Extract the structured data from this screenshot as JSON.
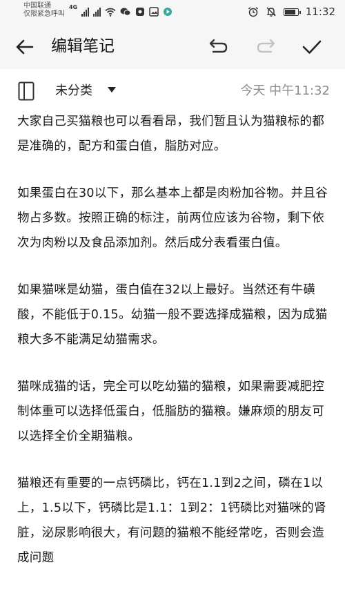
{
  "status_bar": {
    "carrier_line1": "中国联通",
    "carrier_line2": "仅限紧急呼叫",
    "network": "4G",
    "time": "11:32",
    "battery_level": 0.85
  },
  "app_bar": {
    "title": "编辑笔记"
  },
  "note": {
    "category": "未分类",
    "timestamp": "今天 中午11:32",
    "paragraphs": [
      "大家自己买猫粮也可以看看昂，我们暂且认为猫粮标的都是准确的，配方和蛋白值，脂肪对应。",
      "如果蛋白在30以下，那么基本上都是肉粉加谷物。并且谷物占多数。按照正确的标注，前两位应该为谷物，剩下依次为肉粉以及食品添加剂。然后成分表看蛋白值。",
      "如果猫咪是幼猫，蛋白值在32以上最好。当然还有牛磺酸，不能低于0.15。幼猫一般不要选择成猫粮，因为成猫粮大多不能满足幼猫需求。",
      "猫咪成猫的话，完全可以吃幼猫的猫粮，如果需要减肥控制体重可以选择低蛋白，低脂肪的猫粮。嫌麻烦的朋友可以选择全价全期猫粮。",
      "猫粮还有重要的一点钙磷比，钙在1.1到2之间，磷在1以上，1.5以下，钙磷比是1.1：1到2：1钙磷比对猫咪的肾脏，泌尿影响很大，有问题的猫粮不能经常吃，否则会造成问题"
    ]
  },
  "icons": {
    "back": "arrow-left-icon",
    "undo": "undo-icon",
    "redo": "redo-icon",
    "confirm": "check-icon",
    "notebook": "notebook-icon",
    "dropdown": "caret-down-icon"
  },
  "colors": {
    "bar_background": "#f6f6f6",
    "text": "#1a1a1a",
    "muted": "#8a8a8a"
  }
}
